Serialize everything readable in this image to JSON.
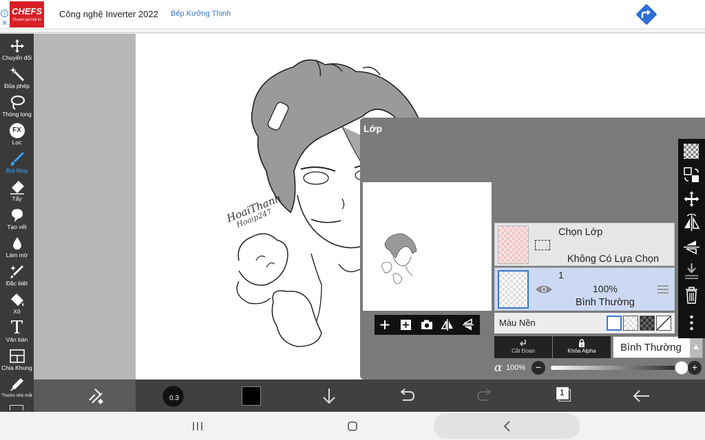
{
  "ad": {
    "logo": "CHEFS",
    "logo_tagline": "Chuyên gia bếp từ",
    "headline": "Công nghệ Inverter 2022",
    "brand": "Bếp Kưỡng Thịnh"
  },
  "tools": [
    {
      "label": "Chuyển đổi",
      "icon": "move-icon"
    },
    {
      "label": "Đũa phép",
      "icon": "magic-wand-icon"
    },
    {
      "label": "Thòng lọng",
      "icon": "lasso-icon"
    },
    {
      "label": "Lọc",
      "icon": "fx-icon",
      "icon_text": "FX"
    },
    {
      "label": "Bút lông",
      "icon": "brush-icon",
      "active": true
    },
    {
      "label": "Tẩy",
      "icon": "eraser-icon"
    },
    {
      "label": "Tạo vết",
      "icon": "smudge-icon"
    },
    {
      "label": "Làm mờ",
      "icon": "blur-icon"
    },
    {
      "label": "Đặc biệt",
      "icon": "special-brush-icon"
    },
    {
      "label": "Xô",
      "icon": "bucket-icon"
    },
    {
      "label": "Văn bản",
      "icon": "text-icon",
      "icon_text": "T"
    },
    {
      "label": "Chia Khung",
      "icon": "frame-divider-icon"
    },
    {
      "label": "Thước nhỏ mắt",
      "icon": "eyedropper-icon"
    }
  ],
  "canvas": {
    "signature_line1": "HoaiThanh",
    "signature_line2": "Hoaip247"
  },
  "bottombar": {
    "brush_size": "0.3",
    "layer_count": "1",
    "primary_color": "#000000"
  },
  "layer_panel": {
    "title": "Lớp",
    "selection_layer": {
      "title": "Chọn Lớp",
      "status": "Không Có Lựa Chọn"
    },
    "layer1": {
      "name": "1",
      "opacity": "100%",
      "blend": "Bình Thường"
    },
    "background": {
      "label": "Màu Nền"
    },
    "clip_label": "Cắt Đoạn",
    "alpha_lock_label": "Khóa Alpha",
    "blend_mode": "Bình Thường",
    "alpha_symbol": "α",
    "alpha_value": "100%",
    "alpha_fraction": 1.0
  },
  "colors": {
    "accent": "#3a78c8",
    "active_tool": "#3aa7ff",
    "toolbar": "#3a3a3a",
    "panel": "#7a7a7a"
  }
}
